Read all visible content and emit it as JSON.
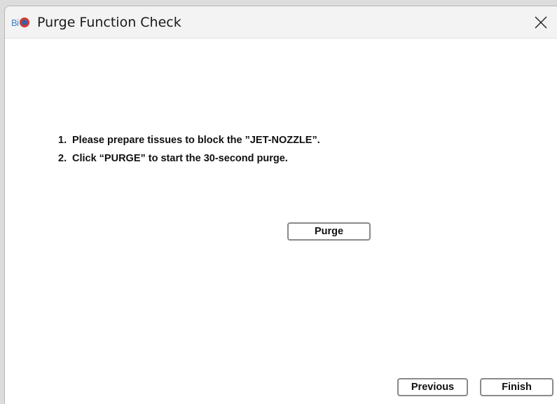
{
  "window": {
    "title": "Purge Function Check",
    "logo_text": "Bi",
    "close_icon": "close-icon"
  },
  "instructions": [
    {
      "number": "1.",
      "text": "Please prepare tissues to block the ”JET-NOZZLE”."
    },
    {
      "number": "2.",
      "text": "Click “PURGE” to start the 30-second purge."
    }
  ],
  "buttons": {
    "purge": "Purge",
    "previous": "Previous",
    "finish": "Finish"
  },
  "colors": {
    "logo_blue": "#3b7fc4",
    "logo_red": "#d23a2d",
    "button_border": "#8a8a8a",
    "titlebar_bg": "#f3f3f3"
  }
}
